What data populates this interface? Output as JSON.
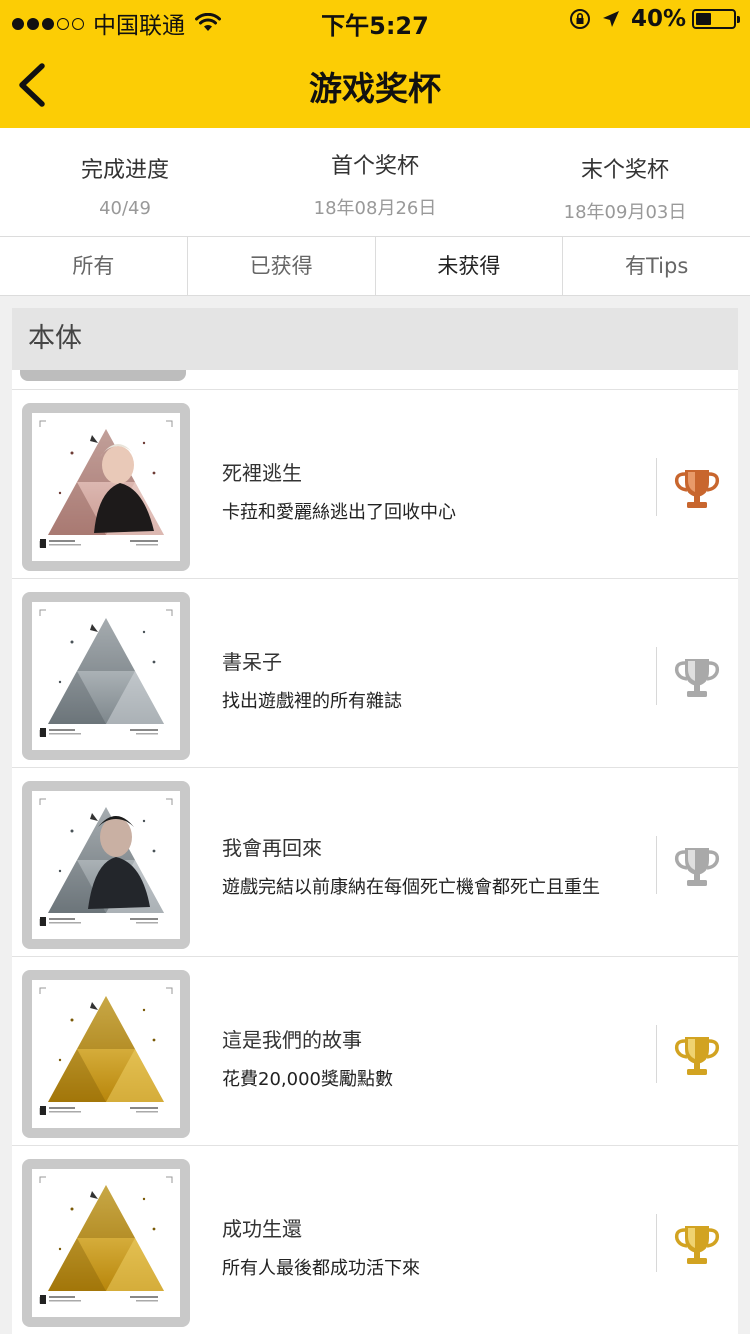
{
  "status_bar": {
    "carrier": "中国联通",
    "time": "下午5:27",
    "battery": "40%",
    "battery_level": 0.4,
    "signal_bars": 3,
    "icons": [
      "signal-dots-icon",
      "wifi-icon",
      "rotation-lock-icon",
      "location-arrow-icon",
      "battery-icon"
    ]
  },
  "nav": {
    "title": "游戏奖杯",
    "back_icon": "chevron-left-icon"
  },
  "stats": [
    {
      "label": "完成进度",
      "value": "40/49"
    },
    {
      "label": "首个奖杯",
      "value": "18年08月26日"
    },
    {
      "label": "末个奖杯",
      "value": "18年09月03日"
    }
  ],
  "tabs": [
    {
      "label": "所有",
      "active": false
    },
    {
      "label": "已获得",
      "active": false
    },
    {
      "label": "未获得",
      "active": true
    },
    {
      "label": "有Tips",
      "active": false
    }
  ],
  "section": {
    "title": "本体"
  },
  "colors": {
    "header_yellow": "#fccd05",
    "bronze": "#c8662e",
    "silver": "#a9a9a9",
    "gold": "#d2a321"
  },
  "trophies": [
    {
      "name": "死裡逃生",
      "desc": "卡菈和愛麗絲逃出了回收中心",
      "grade": "bronze",
      "art": "portrait-woman-pink"
    },
    {
      "name": "書呆子",
      "desc": "找出遊戲裡的所有雜誌",
      "grade": "silver",
      "art": "triangle-silver"
    },
    {
      "name": "我會再回來",
      "desc": "遊戲完結以前康納在每個死亡機會都死亡且重生",
      "grade": "silver",
      "art": "portrait-man-dark"
    },
    {
      "name": "這是我們的故事",
      "desc": "花費20,000獎勵點數",
      "grade": "gold",
      "art": "triangle-gold"
    },
    {
      "name": "成功生還",
      "desc": "所有人最後都成功活下來",
      "grade": "gold",
      "art": "triangle-gold"
    }
  ]
}
